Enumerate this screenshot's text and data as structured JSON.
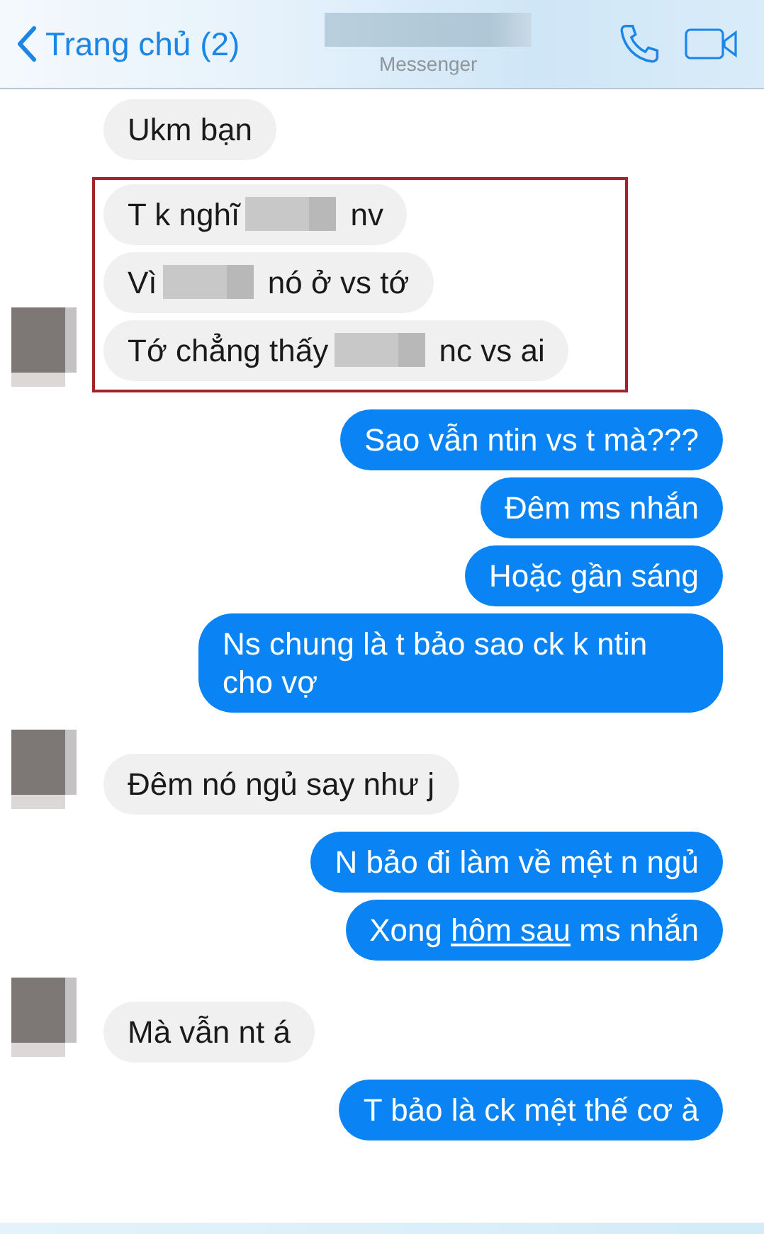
{
  "header": {
    "back_label": "Trang chủ (2)",
    "title_redacted": true,
    "subtitle": "Messenger"
  },
  "groups": [
    {
      "kind": "received",
      "messages": [
        {
          "parts": [
            {
              "kind": "text",
              "text": "Ukm bạn"
            }
          ]
        }
      ]
    },
    {
      "kind": "received",
      "avatar": true,
      "highlighted": true,
      "messages": [
        {
          "parts": [
            {
              "kind": "text",
              "text": "T k nghĩ"
            },
            {
              "kind": "redaction"
            },
            {
              "kind": "text",
              "text": "nv"
            }
          ]
        },
        {
          "parts": [
            {
              "kind": "text",
              "text": "Vì"
            },
            {
              "kind": "redaction"
            },
            {
              "kind": "text",
              "text": "nó ở vs tớ"
            }
          ]
        },
        {
          "parts": [
            {
              "kind": "text",
              "text": "Tớ chẳng thấy"
            },
            {
              "kind": "redaction"
            },
            {
              "kind": "text",
              "text": "nc vs ai"
            }
          ]
        }
      ]
    },
    {
      "kind": "sent",
      "messages": [
        {
          "parts": [
            {
              "kind": "text",
              "text": "Sao vẫn ntin vs t mà???"
            }
          ]
        },
        {
          "parts": [
            {
              "kind": "text",
              "text": "Đêm ms nhắn"
            }
          ]
        },
        {
          "parts": [
            {
              "kind": "text",
              "text": "Hoặc gần sáng"
            }
          ]
        },
        {
          "parts": [
            {
              "kind": "text",
              "text": "Ns chung là t bảo sao ck k ntin cho vợ"
            }
          ]
        }
      ]
    },
    {
      "kind": "received",
      "avatar": true,
      "messages": [
        {
          "parts": [
            {
              "kind": "text",
              "text": "Đêm nó ngủ say như j"
            }
          ]
        }
      ]
    },
    {
      "kind": "sent",
      "messages": [
        {
          "parts": [
            {
              "kind": "text",
              "text": "N bảo đi làm về mệt n ngủ"
            }
          ]
        },
        {
          "parts": [
            {
              "kind": "text",
              "text": "Xong"
            },
            {
              "kind": "link",
              "text": "hôm sau"
            },
            {
              "kind": "text",
              "text": "ms nhắn"
            }
          ]
        }
      ]
    },
    {
      "kind": "received",
      "avatar": true,
      "messages": [
        {
          "parts": [
            {
              "kind": "text",
              "text": "Mà vẫn nt á"
            }
          ]
        }
      ]
    },
    {
      "kind": "sent",
      "messages": [
        {
          "parts": [
            {
              "kind": "text",
              "text": "T bảo là ck mệt thế cơ à"
            }
          ]
        }
      ]
    }
  ]
}
